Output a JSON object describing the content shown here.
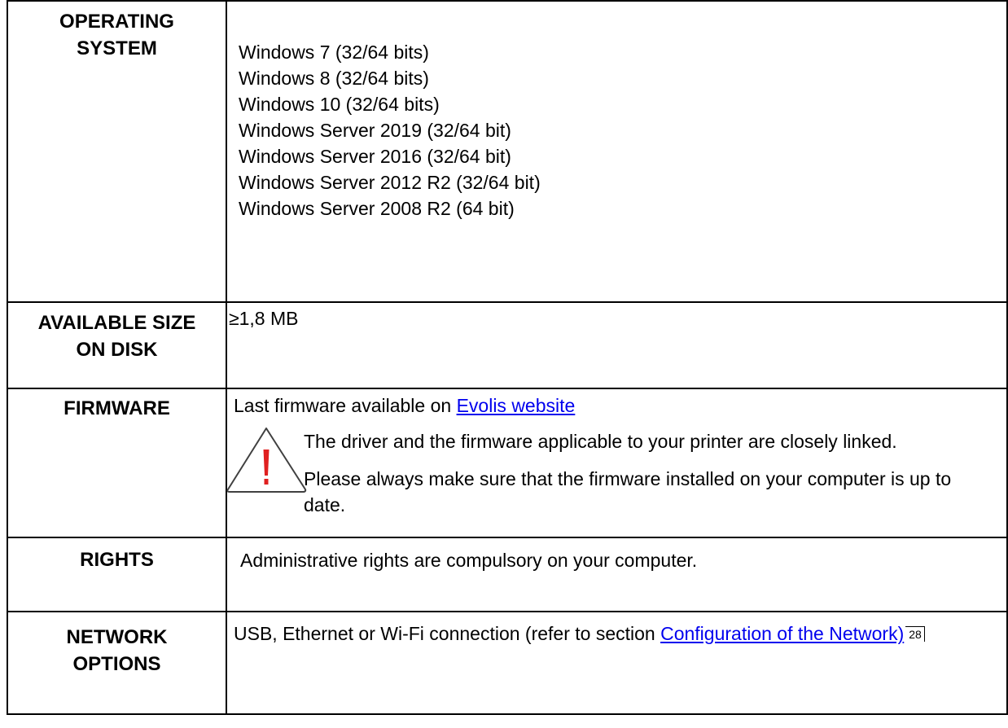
{
  "rows": {
    "os": {
      "label_line1": "OPERATING",
      "label_line2": "SYSTEM",
      "values": [
        "Windows 7 (32/64 bits)",
        "Windows 8 (32/64 bits)",
        "Windows 10 (32/64 bits)",
        "Windows Server 2019 (32/64 bit)",
        "Windows Server 2016 (32/64 bit)",
        "Windows Server 2012 R2 (32/64 bit)",
        "Windows Server 2008 R2 (64 bit)"
      ]
    },
    "disk": {
      "label_line1": "AVAILABLE SIZE",
      "label_line2": "ON DISK",
      "value": "≥1,8 MB"
    },
    "firmware": {
      "label": "FIRMWARE",
      "line_prefix": "Last firmware available on ",
      "link_text": "Evolis website",
      "warning_icon": "warning-triangle-icon",
      "warning_text_1": "The driver and the firmware applicable to your printer are closely linked.",
      "warning_text_2": "Please always make sure that the firmware installed on your computer is up to date."
    },
    "rights": {
      "label": "RIGHTS",
      "value": "Administrative rights are compulsory on your computer."
    },
    "network": {
      "label_line1": "NETWORK",
      "label_line2": "OPTIONS",
      "text_prefix": "USB, Ethernet or Wi-Fi connection (refer to section ",
      "link_text": "Configuration of the Network)",
      "page_ref": "28"
    }
  },
  "colors": {
    "link": "#0000ee",
    "warning_red": "#e02020",
    "border": "#000000"
  }
}
